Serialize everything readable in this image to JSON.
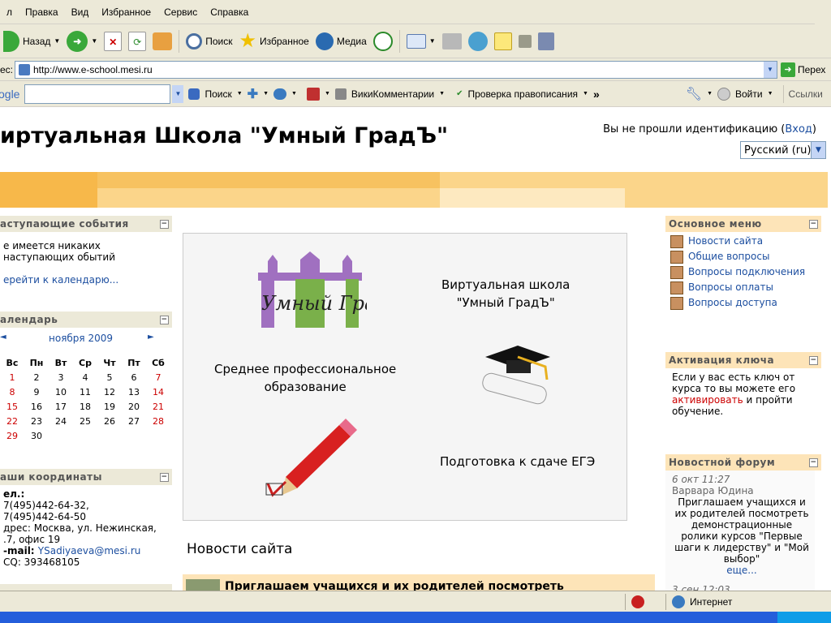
{
  "menubar": {
    "items": [
      "л",
      "Правка",
      "Вид",
      "Избранное",
      "Сервис",
      "Справка"
    ]
  },
  "toolbar": {
    "back": "Назад",
    "search": "Поиск",
    "favorites": "Избранное",
    "media": "Медиа"
  },
  "addressbar": {
    "label": "ес:",
    "url": "http://www.e-school.mesi.ru",
    "go": "Перех"
  },
  "googlebar": {
    "logo": "ogle",
    "search": "Поиск",
    "wiki": "ВикиКомментарии",
    "spell": "Проверка правописания",
    "more": "»",
    "login": "Войти",
    "links": "Ссылки"
  },
  "site": {
    "title": "иртуальная Школа \"Умный ГрадЪ\"",
    "login_prefix": "Вы не прошли идентификацию (",
    "login_link": "Вход",
    "login_suffix": ")",
    "language": "Русский (ru)"
  },
  "left": {
    "events": {
      "title": "аступающие события",
      "text": "е имеется никаких наступающих обытий",
      "link": "ерейти к календарю..."
    },
    "calendar": {
      "title": "алендарь",
      "prev": "◄",
      "month": "ноября 2009",
      "next": "►",
      "days": [
        "Вс",
        "Пн",
        "Вт",
        "Ср",
        "Чт",
        "Пт",
        "Сб"
      ],
      "weeks": [
        [
          "1",
          "2",
          "3",
          "4",
          "5",
          "6",
          "7"
        ],
        [
          "8",
          "9",
          "10",
          "11",
          "12",
          "13",
          "14"
        ],
        [
          "15",
          "16",
          "17",
          "18",
          "19",
          "20",
          "21"
        ],
        [
          "22",
          "23",
          "24",
          "25",
          "26",
          "27",
          "28"
        ],
        [
          "29",
          "30",
          "",
          "",
          "",
          "",
          ""
        ]
      ]
    },
    "contacts": {
      "title": "аши координаты",
      "l1": "ел.:",
      "l2": "7(495)442-64-32,",
      "l3": "7(495)442-64-50",
      "l4": "дрес: Москва, ул. Нежинская,",
      "l5": ".7, офис 19",
      "l6_label": "-mail: ",
      "l6_link": "YSadiyaeva@mesi.ru",
      "l7": "CQ: 393468105"
    }
  },
  "center": {
    "logo_text": "Умный Градъ",
    "school": "Виртуальная школа\n\"Умный ГрадЪ\"",
    "secondary": "Среднее профессиональное\nобразование",
    "exam": "Подготовка к сдаче ЕГЭ",
    "news_title": "Новости сайта",
    "news_first": "Приглашаем учащихся и их родителей посмотреть"
  },
  "right": {
    "menu": {
      "title": "Основное меню",
      "items": [
        "Новости сайта",
        "Общие вопросы",
        "Вопросы подключения",
        "Вопросы оплаты",
        "Вопросы доступа"
      ]
    },
    "activation": {
      "title": "Активация ключа",
      "text1": "Если у вас есть ключ от курса то вы можете его ",
      "link": "активировать",
      "text2": " и пройти обучение."
    },
    "forum": {
      "title": "Новостной форум",
      "date": "6 окт 11:27",
      "author": "Варвара Юдина",
      "text": "Приглашаем учащихся и их родителей посмотреть демонстрационные ролики курсов \"Первые шаги к лидерству\" и \"Мой выбор\"",
      "more": "еще...",
      "date2": "3 сен 12:03"
    }
  },
  "status": {
    "zone": "Интернет"
  }
}
